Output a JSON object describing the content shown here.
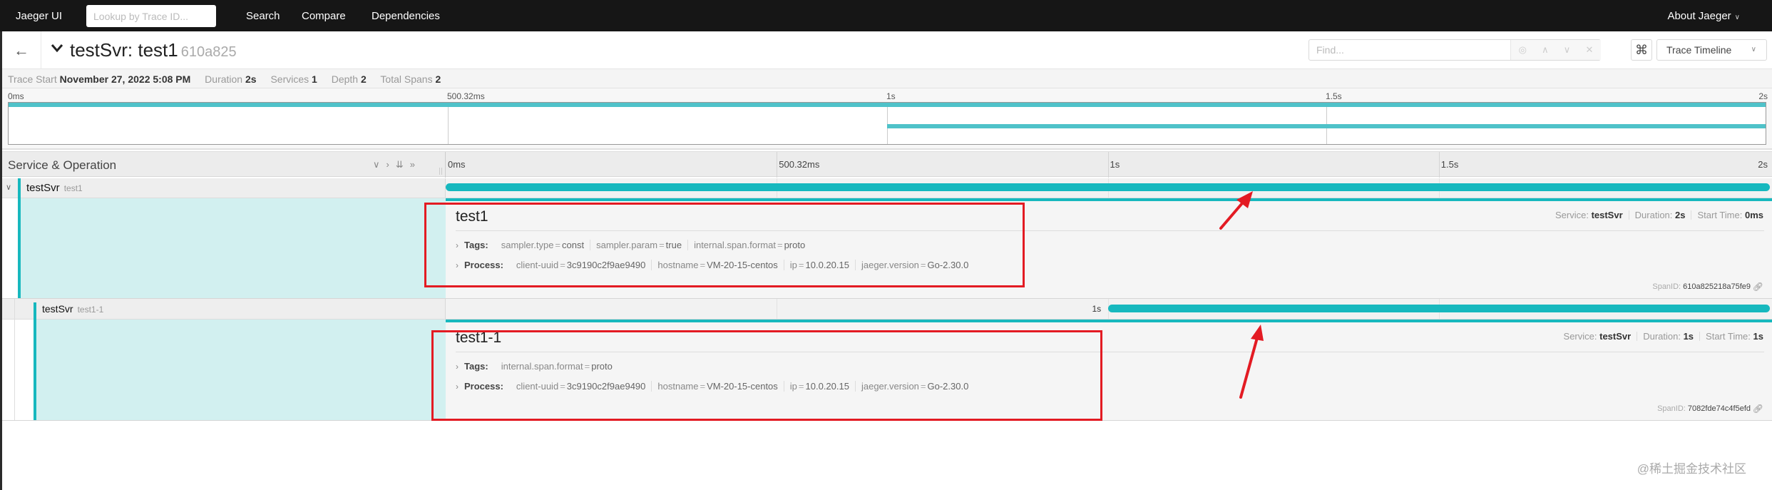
{
  "nav": {
    "brand": "Jaeger UI",
    "lookup_placeholder": "Lookup by Trace ID...",
    "links": [
      "Search",
      "Compare",
      "Dependencies"
    ],
    "about": "About Jaeger"
  },
  "title_bar": {
    "service": "testSvr",
    "operation": "test1",
    "title": "testSvr: test1",
    "trace_id_short": "610a825",
    "find_placeholder": "Find...",
    "view_mode": "Trace Timeline"
  },
  "summary": {
    "trace_start_label": "Trace Start",
    "trace_start": "November 27, 2022 5:08 PM",
    "duration_label": "Duration",
    "duration": "2s",
    "services_label": "Services",
    "services": "1",
    "depth_label": "Depth",
    "depth": "2",
    "total_spans_label": "Total Spans",
    "total_spans": "2"
  },
  "timeline": {
    "ticks": [
      "0ms",
      "500.32ms",
      "1s",
      "1.5s",
      "2s"
    ],
    "tick_fractions": [
      0,
      0.25,
      0.5,
      0.75,
      1
    ],
    "header_title": "Service & Operation",
    "header_controls": [
      "collapse-one",
      "expand-one",
      "collapse-all",
      "expand-all"
    ]
  },
  "spans": [
    {
      "service": "testSvr",
      "operation": "test1",
      "depth": 0,
      "start_fraction": 0,
      "duration_fraction": 1,
      "bar_label": "",
      "details": {
        "title": "test1",
        "service_label": "Service:",
        "service": "testSvr",
        "duration_label": "Duration:",
        "duration": "2s",
        "start_label": "Start Time:",
        "start": "0ms",
        "tags_label": "Tags:",
        "tags": [
          {
            "k": "sampler.type",
            "v": "const"
          },
          {
            "k": "sampler.param",
            "v": "true"
          },
          {
            "k": "internal.span.format",
            "v": "proto"
          }
        ],
        "process_label": "Process:",
        "process": [
          {
            "k": "client-uuid",
            "v": "3c9190c2f9ae9490"
          },
          {
            "k": "hostname",
            "v": "VM-20-15-centos"
          },
          {
            "k": "ip",
            "v": "10.0.20.15"
          },
          {
            "k": "jaeger.version",
            "v": "Go-2.30.0"
          }
        ],
        "span_id_label": "SpanID:",
        "span_id": "610a825218a75fe9"
      }
    },
    {
      "service": "testSvr",
      "operation": "test1-1",
      "depth": 1,
      "start_fraction": 0.5,
      "duration_fraction": 0.5,
      "bar_label": "1s",
      "details": {
        "title": "test1-1",
        "service_label": "Service:",
        "service": "testSvr",
        "duration_label": "Duration:",
        "duration": "1s",
        "start_label": "Start Time:",
        "start": "1s",
        "tags_label": "Tags:",
        "tags": [
          {
            "k": "internal.span.format",
            "v": "proto"
          }
        ],
        "process_label": "Process:",
        "process": [
          {
            "k": "client-uuid",
            "v": "3c9190c2f9ae9490"
          },
          {
            "k": "hostname",
            "v": "VM-20-15-centos"
          },
          {
            "k": "ip",
            "v": "10.0.20.15"
          },
          {
            "k": "jaeger.version",
            "v": "Go-2.30.0"
          }
        ],
        "span_id_label": "SpanID:",
        "span_id": "7082fde74c4f5efd"
      }
    }
  ],
  "colors": {
    "span_bar": "#17b8be",
    "minimap_bar": "#4fc2c9",
    "details_bg": "#d2f0f0",
    "annotation": "#e31b23",
    "nav_bg": "#161616"
  },
  "watermark": "@稀土掘金技术社区"
}
